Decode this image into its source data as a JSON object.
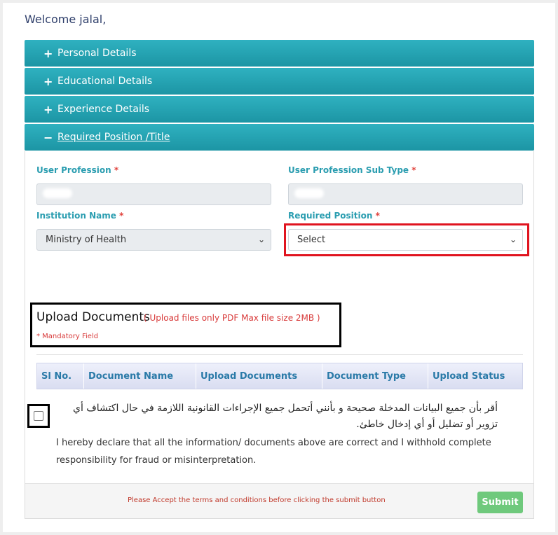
{
  "welcome": "Welcome jalal,",
  "accordion": [
    {
      "symbol": "+",
      "label": "Personal Details"
    },
    {
      "symbol": "+",
      "label": "Educational Details"
    },
    {
      "symbol": "+",
      "label": "Experience Details"
    },
    {
      "symbol": "−",
      "label": "Required Position /Title"
    }
  ],
  "form": {
    "user_profession_label": "User Profession",
    "user_profession_sub_label": "User Profession Sub Type",
    "institution_label": "Institution Name",
    "institution_value": "Ministry of Health",
    "required_position_label": "Required Position",
    "required_position_value": "Select",
    "required_mark": "*"
  },
  "upload": {
    "title": "Upload Documents",
    "note": "( Upload files only PDF Max file size 2MB )",
    "mandatory": "* Mandatory Field",
    "columns": [
      "Sl No.",
      "Document Name",
      "Upload Documents",
      "Document Type",
      "Upload Status"
    ]
  },
  "declaration": {
    "arabic": "أقر بأن جميع البيانات المدخلة صحيحة و بأنني أتحمل جميع الإجراءات القانونية اللازمة في حال اكتشاف أي تزوير أو تضليل أو أي إدخال خاطئ.",
    "english": "I hereby declare that all the information/ documents above are correct and I withhold complete responsibility for fraud or misinterpretation."
  },
  "footer": {
    "message": "Please Accept the terms and conditions before clicking the submit button",
    "submit_label": "Submit"
  },
  "colors": {
    "accordion": "#1c95a4",
    "label": "#2a9db0",
    "required": "#e0403a",
    "highlight": "#e0141f",
    "submit": "#6fc97c"
  }
}
